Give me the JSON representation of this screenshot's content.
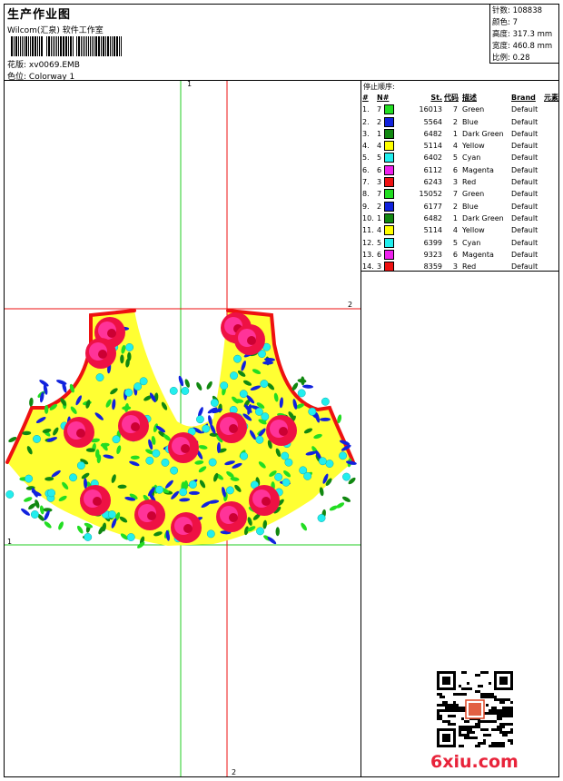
{
  "header": {
    "title": "生产作业图",
    "subtitle": "Wilcom(汇泉) 软件工作室",
    "design_label": "花版:",
    "design_name": "xv0069.EMB",
    "colorway_label": "色位:",
    "colorway": "Colorway 1"
  },
  "stats": [
    {
      "label": "针数:",
      "value": "108838"
    },
    {
      "label": "颜色:",
      "value": "7"
    },
    {
      "label": "高度:",
      "value": "317.3 mm"
    },
    {
      "label": "宽度:",
      "value": "460.8 mm"
    },
    {
      "label": "比例:",
      "value": "0.28"
    }
  ],
  "sequence": {
    "caption": "停止顺序:",
    "columns": [
      "#",
      "N#",
      "St.",
      "代码",
      "描述",
      "Brand",
      "元素"
    ],
    "rows": [
      {
        "idx": "1.",
        "n": "7",
        "color": "#22dd22",
        "st": "16013",
        "code": "7",
        "desc": "Green",
        "brand": "Default"
      },
      {
        "idx": "2.",
        "n": "2",
        "color": "#1122dd",
        "st": "5564",
        "code": "2",
        "desc": "Blue",
        "brand": "Default"
      },
      {
        "idx": "3.",
        "n": "1",
        "color": "#118811",
        "st": "6482",
        "code": "1",
        "desc": "Dark Green",
        "brand": "Default"
      },
      {
        "idx": "4.",
        "n": "4",
        "color": "#ffff00",
        "st": "5114",
        "code": "4",
        "desc": "Yellow",
        "brand": "Default"
      },
      {
        "idx": "5.",
        "n": "5",
        "color": "#22eeee",
        "st": "6402",
        "code": "5",
        "desc": "Cyan",
        "brand": "Default"
      },
      {
        "idx": "6.",
        "n": "6",
        "color": "#ee22ee",
        "st": "6112",
        "code": "6",
        "desc": "Magenta",
        "brand": "Default"
      },
      {
        "idx": "7.",
        "n": "3",
        "color": "#ee1111",
        "st": "6243",
        "code": "3",
        "desc": "Red",
        "brand": "Default"
      },
      {
        "idx": "8.",
        "n": "7",
        "color": "#22dd22",
        "st": "15052",
        "code": "7",
        "desc": "Green",
        "brand": "Default"
      },
      {
        "idx": "9.",
        "n": "2",
        "color": "#1122dd",
        "st": "6177",
        "code": "2",
        "desc": "Blue",
        "brand": "Default"
      },
      {
        "idx": "10.",
        "n": "1",
        "color": "#118811",
        "st": "6482",
        "code": "1",
        "desc": "Dark Green",
        "brand": "Default"
      },
      {
        "idx": "11.",
        "n": "4",
        "color": "#ffff00",
        "st": "5114",
        "code": "4",
        "desc": "Yellow",
        "brand": "Default"
      },
      {
        "idx": "12.",
        "n": "5",
        "color": "#22eeee",
        "st": "6399",
        "code": "5",
        "desc": "Cyan",
        "brand": "Default"
      },
      {
        "idx": "13.",
        "n": "6",
        "color": "#ee22ee",
        "st": "9323",
        "code": "6",
        "desc": "Magenta",
        "brand": "Default"
      },
      {
        "idx": "14.",
        "n": "3",
        "color": "#ee1111",
        "st": "8359",
        "code": "3",
        "desc": "Red",
        "brand": "Default"
      }
    ]
  },
  "guides": {
    "label1": "1",
    "label2": "2"
  },
  "watermark": "6xiu.com",
  "colors": {
    "guide_green": "#22cc22",
    "guide_red": "#ee1111",
    "logo_red": "#e8233a"
  }
}
